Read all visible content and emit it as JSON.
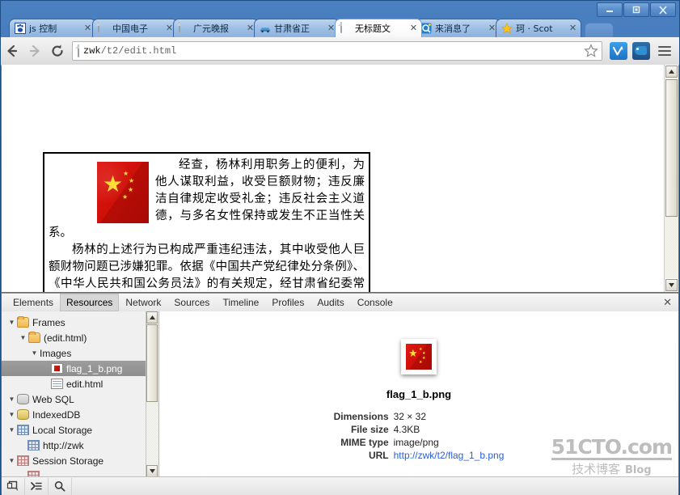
{
  "window": {
    "buttons": [
      {
        "name": "minimize",
        "glyph": "—"
      },
      {
        "name": "maximize",
        "glyph": "❐"
      },
      {
        "name": "close",
        "glyph": "✕"
      }
    ]
  },
  "tabs": [
    {
      "label": "js 控制",
      "icon": "paw-icon",
      "active": false,
      "close": "✕"
    },
    {
      "label": "中国电子",
      "icon": "page-icon",
      "active": false,
      "close": "✕"
    },
    {
      "label": "广元晚报",
      "icon": "page-icon",
      "active": false,
      "close": "✕"
    },
    {
      "label": "甘肃省正",
      "icon": "car-icon",
      "active": false,
      "close": "✕"
    },
    {
      "label": "无标题文",
      "icon": "page-icon",
      "active": true,
      "close": "✕"
    },
    {
      "label": "来消息了",
      "icon": "qq-icon",
      "active": false,
      "close": "✕"
    },
    {
      "label": "珂 · Scot",
      "icon": "star-icon",
      "active": false,
      "close": "✕"
    }
  ],
  "toolbar": {
    "back": "←",
    "forward": "→",
    "reload": "⟳",
    "url_prefix": "zwk",
    "url_suffix": "/t2/edit.html",
    "url_full": "zwk/t2/edit.html",
    "bookmark_star": "☆",
    "extension_1": "v-extension-icon",
    "extension_2": "bird-extension-icon",
    "menu": "hamburger-menu-icon"
  },
  "page": {
    "paragraph_1": "经查，杨林利用职务上的便利，为他人谋取利益，收受巨额财物；违反廉洁自律规定收受礼金；违反社会主义道德，与多名女性保持或发生不正当性关系。",
    "paragraph_2": "杨林的上述行为已构成严重违纪违法，其中收受他人巨额财物问题已涉嫌犯罪。依据《中国共产党纪律处分条例》、《中华人民共和国公务员法》的有关规定，经甘肃省纪委常委会审议并报甘肃省委批准，决定给予杨林开除党籍，行政开除处分由有关部门予以办理；收缴其违纪违法所得。其涉嫌犯罪问题移送司法机关依法处理。",
    "inline_image": "china-flag-image"
  },
  "devtools": {
    "tabs": [
      {
        "label": "Elements",
        "selected": false
      },
      {
        "label": "Resources",
        "selected": true
      },
      {
        "label": "Network",
        "selected": false
      },
      {
        "label": "Sources",
        "selected": false
      },
      {
        "label": "Timeline",
        "selected": false
      },
      {
        "label": "Profiles",
        "selected": false
      },
      {
        "label": "Audits",
        "selected": false
      },
      {
        "label": "Console",
        "selected": false
      }
    ],
    "close": "✕",
    "tree": [
      {
        "label": "Frames",
        "indent": 0,
        "arrow": "▼",
        "icon": "folder-icon",
        "selected": false
      },
      {
        "label": "(edit.html)",
        "indent": 1,
        "arrow": "▼",
        "icon": "folder-icon",
        "selected": false
      },
      {
        "label": "Images",
        "indent": 2,
        "arrow": "▼",
        "icon": "none",
        "selected": false
      },
      {
        "label": "flag_1_b.png",
        "indent": 3,
        "arrow": "",
        "icon": "image-file-icon",
        "selected": true
      },
      {
        "label": "edit.html",
        "indent": 3,
        "arrow": "",
        "icon": "html-file-icon",
        "selected": false
      },
      {
        "label": "Web SQL",
        "indent": 0,
        "arrow": "▼",
        "icon": "database-icon",
        "selected": false
      },
      {
        "label": "IndexedDB",
        "indent": 0,
        "arrow": "▼",
        "icon": "database-gold-icon",
        "selected": false
      },
      {
        "label": "Local Storage",
        "indent": 0,
        "arrow": "▼",
        "icon": "grid-blue-icon",
        "selected": false
      },
      {
        "label": "http://zwk",
        "indent": 1,
        "arrow": "",
        "icon": "grid-blue-icon",
        "selected": false
      },
      {
        "label": "Session Storage",
        "indent": 0,
        "arrow": "▼",
        "icon": "grid-pink-icon",
        "selected": false
      }
    ],
    "resource": {
      "filename": "flag_1_b.png",
      "rows": [
        {
          "key": "Dimensions",
          "value": "32 × 32",
          "link": false
        },
        {
          "key": "File size",
          "value": "4.3KB",
          "link": false
        },
        {
          "key": "MIME type",
          "value": "image/png",
          "link": false
        },
        {
          "key": "URL",
          "value": "http://zwk/t2/flag_1_b.png",
          "link": true
        }
      ]
    },
    "footer": [
      {
        "name": "dock-toggle-button",
        "glyph": "❐"
      },
      {
        "name": "console-drawer-button",
        "glyph": "≽"
      },
      {
        "name": "search-button",
        "glyph": "⌕"
      }
    ]
  },
  "watermark": {
    "line1": "51CTO.com",
    "line2": "技术博客",
    "line3": "Blog"
  },
  "colors": {
    "window_chrome": "#3b6ea5",
    "accent_link": "#2b5fd9",
    "flag_red": "#cf1008",
    "flag_yellow": "#ffde34",
    "selected_row": "#8e8e8e"
  }
}
